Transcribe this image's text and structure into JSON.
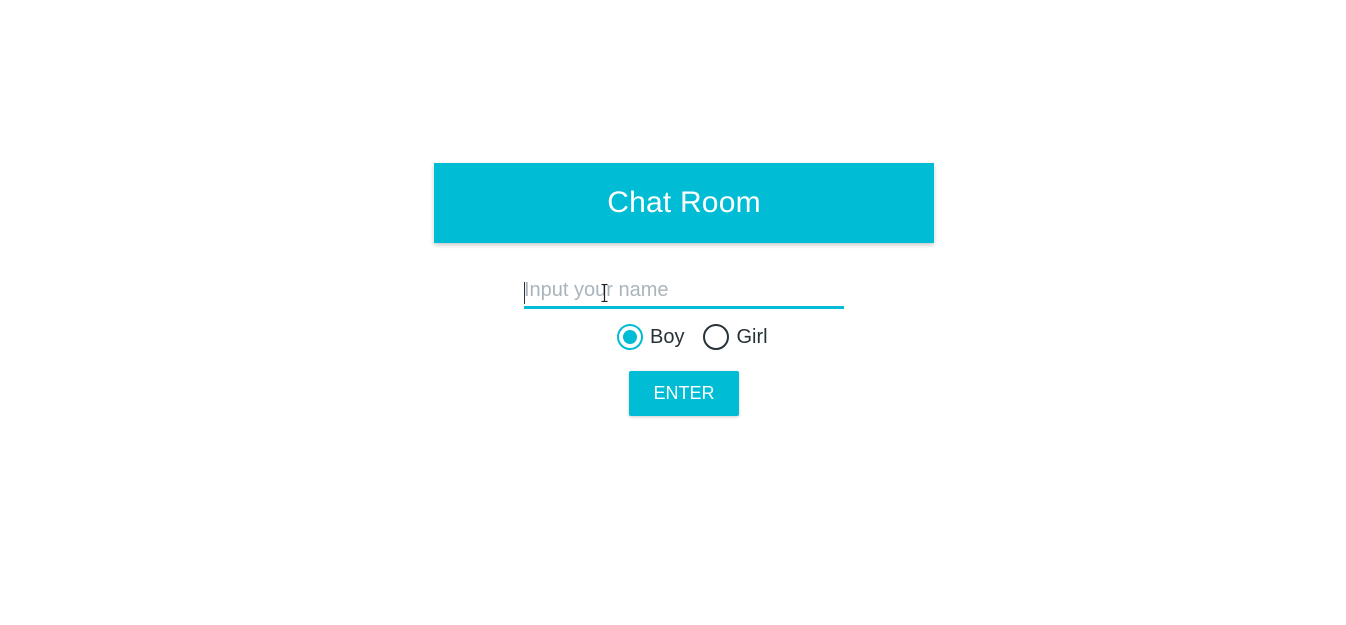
{
  "header": {
    "title": "Chat Room"
  },
  "name_field": {
    "placeholder": "Input your name",
    "value": ""
  },
  "gender": {
    "options": [
      {
        "label": "Boy",
        "checked": true
      },
      {
        "label": "Girl",
        "checked": false
      }
    ]
  },
  "actions": {
    "enter_label": "ENTER"
  },
  "colors": {
    "accent": "#00bcd4",
    "text": "#263238",
    "placeholder": "#aab4bb",
    "background": "#ffffff"
  },
  "icons": {
    "text_cursor": "i-beam-cursor-icon"
  }
}
